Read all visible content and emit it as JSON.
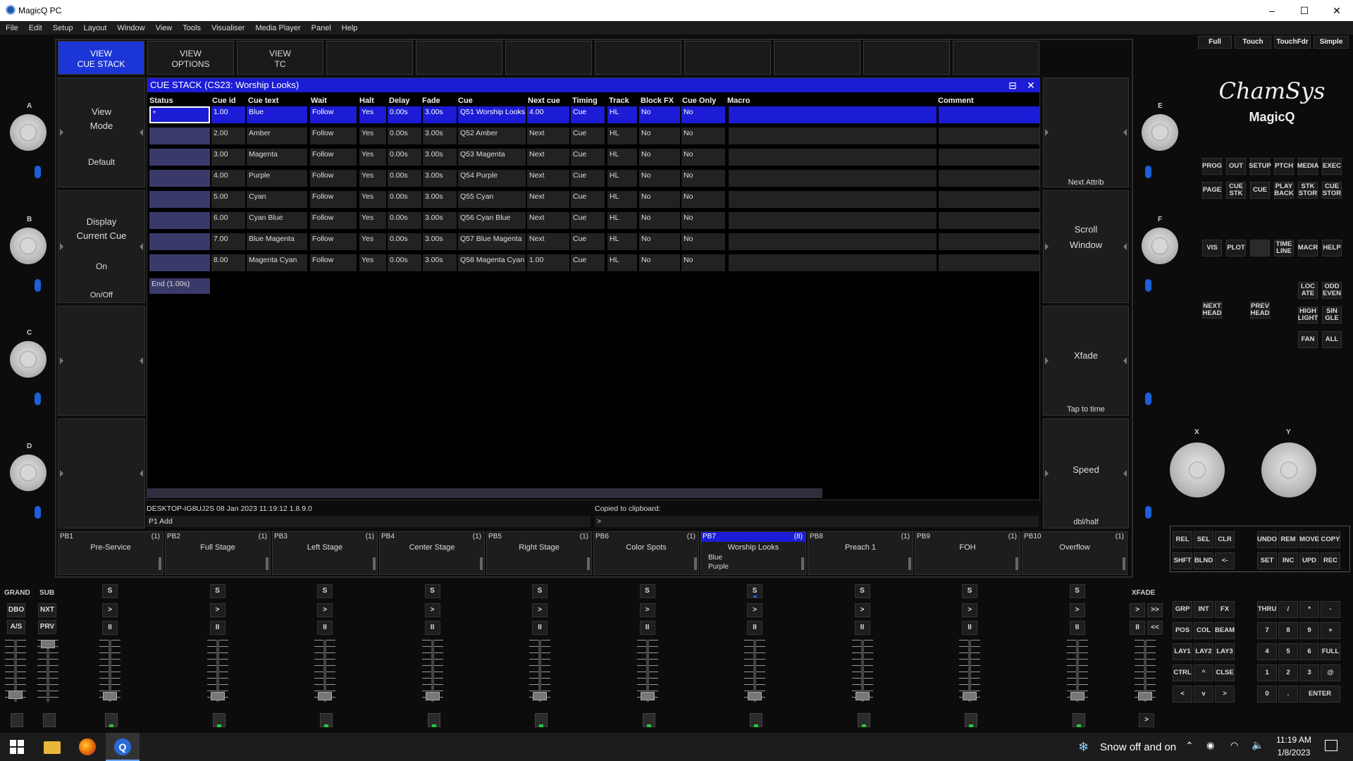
{
  "window": {
    "title": "MagicQ PC",
    "minimize": "–",
    "maximize": "☐",
    "close": "✕"
  },
  "menu": [
    "File",
    "Edit",
    "Setup",
    "Layout",
    "Window",
    "View",
    "Tools",
    "Visualiser",
    "Media Player",
    "Panel",
    "Help"
  ],
  "mode_buttons": [
    "Full",
    "Touch",
    "TouchFdr",
    "Simple"
  ],
  "top_buttons": [
    {
      "l1": "VIEW",
      "l2": "CUE STACK",
      "active": true
    },
    {
      "l1": "VIEW",
      "l2": "OPTIONS",
      "active": false
    },
    {
      "l1": "VIEW",
      "l2": "TC",
      "active": false
    },
    {
      "l1": "",
      "l2": ""
    },
    {
      "l1": "",
      "l2": ""
    },
    {
      "l1": "",
      "l2": ""
    },
    {
      "l1": "",
      "l2": ""
    },
    {
      "l1": "",
      "l2": ""
    },
    {
      "l1": "",
      "l2": ""
    },
    {
      "l1": "",
      "l2": ""
    },
    {
      "l1": "",
      "l2": ""
    }
  ],
  "left_softkeys": [
    {
      "title": "View\nMode",
      "sub": "Default",
      "foot": ""
    },
    {
      "title": "Display\nCurrent Cue",
      "sub": "On",
      "foot": "On/Off"
    },
    {
      "title": "",
      "sub": "",
      "foot": ""
    },
    {
      "title": "",
      "sub": "",
      "foot": ""
    }
  ],
  "right_softkeys": [
    {
      "title": "",
      "foot": "Next Attrib"
    },
    {
      "title": "Scroll\nWindow",
      "foot": ""
    },
    {
      "title": "Xfade",
      "foot": "Tap to time"
    },
    {
      "title": "Speed",
      "foot": "dbl/half"
    }
  ],
  "encoders_left": [
    "A",
    "B",
    "C",
    "D"
  ],
  "encoders_right": [
    "E",
    "F"
  ],
  "encoders_xy": [
    "X",
    "Y"
  ],
  "brand": {
    "logo": "ChamSys",
    "product": "MagicQ"
  },
  "cue_stack": {
    "title": "CUE STACK (CS23: Worship Looks)",
    "columns": [
      "Status",
      "Cue id",
      "Cue text",
      "Wait",
      "Halt",
      "Delay",
      "Fade",
      "Cue",
      "Next cue",
      "Timing",
      "Track",
      "Block FX",
      "Cue Only",
      "Macro",
      "Comment"
    ],
    "rows": [
      [
        "*",
        "1.00",
        "Blue",
        "Follow",
        "Yes",
        "0.00s",
        "3.00s",
        "Q51 Worship Looks",
        "4.00",
        "Cue",
        "HL",
        "No",
        "No",
        "",
        ""
      ],
      [
        "",
        "2.00",
        "Amber",
        "Follow",
        "Yes",
        "0.00s",
        "3.00s",
        "Q52 Amber",
        "Next",
        "Cue",
        "HL",
        "No",
        "No",
        "",
        ""
      ],
      [
        "",
        "3.00",
        "Magenta",
        "Follow",
        "Yes",
        "0.00s",
        "3.00s",
        "Q53 Magenta",
        "Next",
        "Cue",
        "HL",
        "No",
        "No",
        "",
        ""
      ],
      [
        "",
        "4.00",
        "Purple",
        "Follow",
        "Yes",
        "0.00s",
        "3.00s",
        "Q54 Purple",
        "Next",
        "Cue",
        "HL",
        "No",
        "No",
        "",
        ""
      ],
      [
        "",
        "5.00",
        "Cyan",
        "Follow",
        "Yes",
        "0.00s",
        "3.00s",
        "Q55 Cyan",
        "Next",
        "Cue",
        "HL",
        "No",
        "No",
        "",
        ""
      ],
      [
        "",
        "6.00",
        "Cyan Blue",
        "Follow",
        "Yes",
        "0.00s",
        "3.00s",
        "Q56 Cyan Blue",
        "Next",
        "Cue",
        "HL",
        "No",
        "No",
        "",
        ""
      ],
      [
        "",
        "7.00",
        "Blue Magenta",
        "Follow",
        "Yes",
        "0.00s",
        "3.00s",
        "Q57 Blue Magenta",
        "Next",
        "Cue",
        "HL",
        "No",
        "No",
        "",
        ""
      ],
      [
        "",
        "8.00",
        "Magenta Cyan",
        "Follow",
        "Yes",
        "0.00s",
        "3.00s",
        "Q58 Magenta Cyan",
        "1.00",
        "Cue",
        "HL",
        "No",
        "No",
        "",
        ""
      ]
    ],
    "end_label": "End (1.00s)"
  },
  "status": {
    "info": "DESKTOP-IG8UJ2S 08 Jan 2023 11:19:12 1.8.9.0",
    "cmd": "P1 Add",
    "clip_label": "Copied to clipboard:",
    "prompt": ">"
  },
  "playbacks": [
    {
      "id": "PB1",
      "name": "Pre-Service",
      "count": "(1)"
    },
    {
      "id": "PB2",
      "name": "Full Stage",
      "count": "(1)"
    },
    {
      "id": "PB3",
      "name": "Left Stage",
      "count": "(1)"
    },
    {
      "id": "PB4",
      "name": "Center Stage",
      "count": "(1)"
    },
    {
      "id": "PB5",
      "name": "Right Stage",
      "count": "(1)"
    },
    {
      "id": "PB6",
      "name": "Color Spots",
      "count": "(1)"
    },
    {
      "id": "PB7",
      "name": "Worship Looks",
      "count": "(8)",
      "line1": "Blue",
      "line2": "Purple",
      "active": true
    },
    {
      "id": "PB8",
      "name": "Preach 1",
      "count": "(1)"
    },
    {
      "id": "PB9",
      "name": "FOH",
      "count": "(1)"
    },
    {
      "id": "PB10",
      "name": "Overflow",
      "count": "(1)"
    }
  ],
  "master": {
    "grand": "GRAND",
    "sub": "SUB",
    "dbo": "DBO",
    "nxt": "NXT",
    "as": "A/S",
    "prv": "PRV",
    "xfade": "XFADE"
  },
  "pb_buttons": {
    "s": "S",
    "go": ">",
    "pause": "II",
    "ff": ">>",
    "rw": "<<"
  },
  "exec_keys": [
    [
      "PROG",
      "OUT",
      "SETUP",
      "PTCH",
      "MEDIA",
      "EXEC"
    ],
    [
      "PAGE",
      "CUE\nSTK",
      "CUE",
      "PLAY\nBACK",
      "STK\nSTOR",
      "CUE\nSTOR"
    ],
    [
      "VIS",
      "PLOT",
      "",
      "TIME\nLINE",
      "MACR",
      "HELP"
    ]
  ],
  "head_keys": {
    "locate": "LOC\nATE",
    "oddeven": "ODD\nEVEN",
    "nexthead": "NEXT\nHEAD",
    "prevhead": "PREV\nHEAD",
    "highlight": "HIGH\nLIGHT",
    "single": "SIN\nGLE",
    "fan": "FAN",
    "all": "ALL"
  },
  "edit_keys": [
    [
      "REL",
      "SEL",
      "CLR",
      "UNDO",
      "REM",
      "MOVE",
      "COPY"
    ],
    [
      "SHFT",
      "BLND",
      "<-",
      "SET",
      "INC",
      "UPD",
      "REC"
    ]
  ],
  "keypad_left": [
    [
      "GRP",
      "INT",
      "FX"
    ],
    [
      "POS",
      "COL",
      "BEAM"
    ],
    [
      "LAY1",
      "LAY2",
      "LAY3"
    ],
    [
      "CTRL",
      "^",
      "CLSE"
    ],
    [
      "<",
      "v",
      ">"
    ]
  ],
  "keypad_right": [
    [
      "THRU",
      "/",
      "*",
      "-"
    ],
    [
      "7",
      "8",
      "9",
      "+"
    ],
    [
      "4",
      "5",
      "6",
      "FULL"
    ],
    [
      "1",
      "2",
      "3",
      "@"
    ],
    [
      "0",
      ".",
      "ENTER"
    ]
  ],
  "taskbar": {
    "weather": "Snow off and on",
    "time": "11:19 AM",
    "date": "1/8/2023"
  },
  "colors": {
    "accent": "#1c1cd6",
    "panel": "#1d1d1d",
    "led": "#1d5fd8",
    "go_led": "#1fcc3c"
  }
}
